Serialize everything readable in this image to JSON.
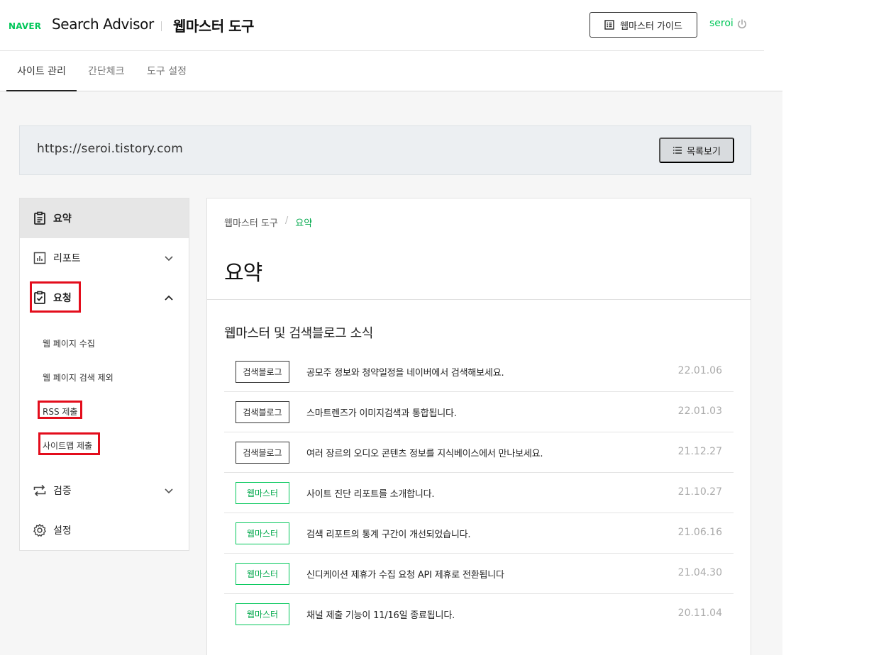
{
  "header": {
    "naver_logo": "NAVER",
    "brand": "Search Advisor",
    "tool_title": "웹마스터 도구",
    "guide_button": "웹마스터 가이드",
    "user_name": "seroi"
  },
  "gnb": {
    "tabs": [
      {
        "label": "사이트 관리"
      },
      {
        "label": "간단체크"
      },
      {
        "label": "도구 설정"
      }
    ]
  },
  "site": {
    "url": "https://seroi.tistory.com",
    "list_button": "목록보기"
  },
  "sidebar": {
    "items": [
      {
        "label": "요약",
        "icon": "clipboard-icon"
      },
      {
        "label": "리포트",
        "icon": "chart-icon"
      },
      {
        "label": "요청",
        "icon": "clipboard-check-icon"
      },
      {
        "label": "검증",
        "icon": "repeat-icon"
      },
      {
        "label": "설정",
        "icon": "gear-icon"
      }
    ],
    "sub_items": [
      {
        "label": "웹 페이지 수집"
      },
      {
        "label": "웹 페이지 검색 제외"
      },
      {
        "label": "RSS 제출"
      },
      {
        "label": "사이트맵 제출"
      }
    ]
  },
  "main": {
    "breadcrumb": {
      "root": "웹마스터 도구",
      "sep": "/",
      "current": "요약"
    },
    "title": "요약",
    "news_title": "웹마스터 및 검색블로그 소식",
    "news": [
      {
        "tag": "검색블로그",
        "text": "공모주 정보와 청약일정을 네이버에서 검색해보세요.",
        "date": "22.01.06"
      },
      {
        "tag": "검색블로그",
        "text": "스마트렌즈가 이미지검색과 통합됩니다.",
        "date": "22.01.03"
      },
      {
        "tag": "검색블로그",
        "text": "여러 장르의 오디오 콘텐츠 정보를 지식베이스에서 만나보세요.",
        "date": "21.12.27"
      },
      {
        "tag": "웹마스터",
        "text": "사이트 진단 리포트를 소개합니다.",
        "date": "21.10.27"
      },
      {
        "tag": "웹마스터",
        "text": "검색 리포트의 통계 구간이 개선되었습니다.",
        "date": "21.06.16"
      },
      {
        "tag": "웹마스터",
        "text": "신디케이션 제휴가 수집 요청 API 제휴로 전환됩니다",
        "date": "21.04.30"
      },
      {
        "tag": "웹마스터",
        "text": "채널 제출 기능이 11/16일 종료됩니다.",
        "date": "20.11.04"
      }
    ]
  },
  "colors": {
    "naver_green": "#03c75a",
    "highlight_red": "#e30d1c"
  }
}
